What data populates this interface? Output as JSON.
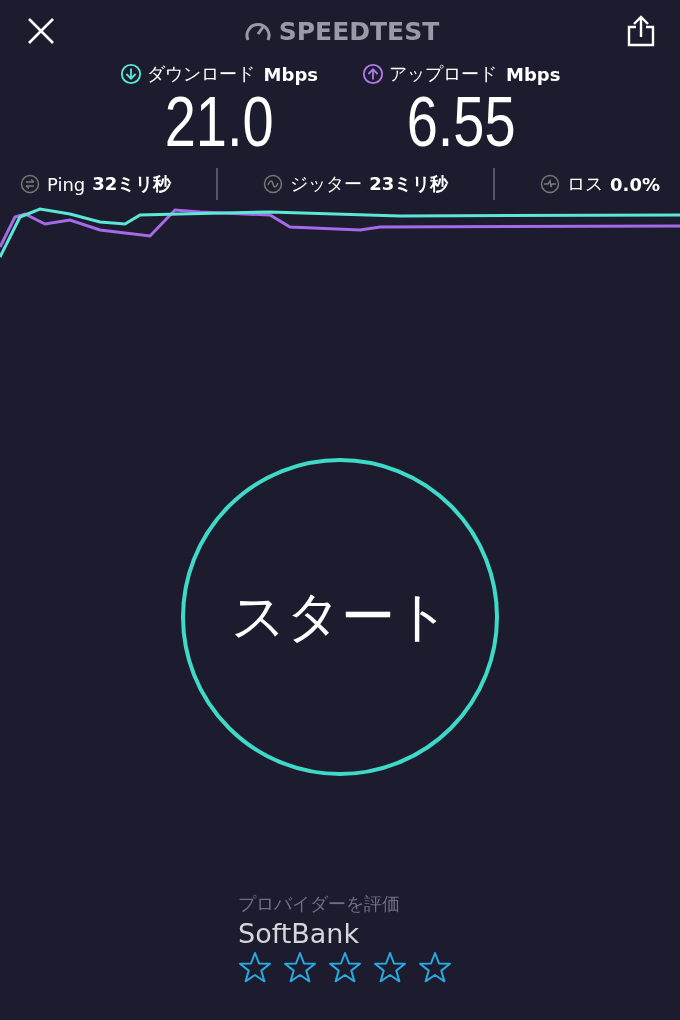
{
  "header": {
    "title": "SPEEDTEST"
  },
  "metrics": [
    {
      "kind": "download",
      "label": "ダウンロード",
      "unit": "Mbps",
      "value": "21.0"
    },
    {
      "kind": "upload",
      "label": "アップロード",
      "unit": "Mbps",
      "value": "6.55"
    }
  ],
  "stats": [
    {
      "kind": "ping",
      "label": "Ping",
      "value": "32ミリ秒"
    },
    {
      "kind": "jitter",
      "label": "ジッター",
      "value": "23ミリ秒"
    },
    {
      "kind": "loss",
      "label": "ロス",
      "value": "0.0%"
    }
  ],
  "start_button": {
    "label": "スタート"
  },
  "provider": {
    "prompt": "プロバイダーを評価",
    "name": "SoftBank",
    "stars": 0
  }
}
